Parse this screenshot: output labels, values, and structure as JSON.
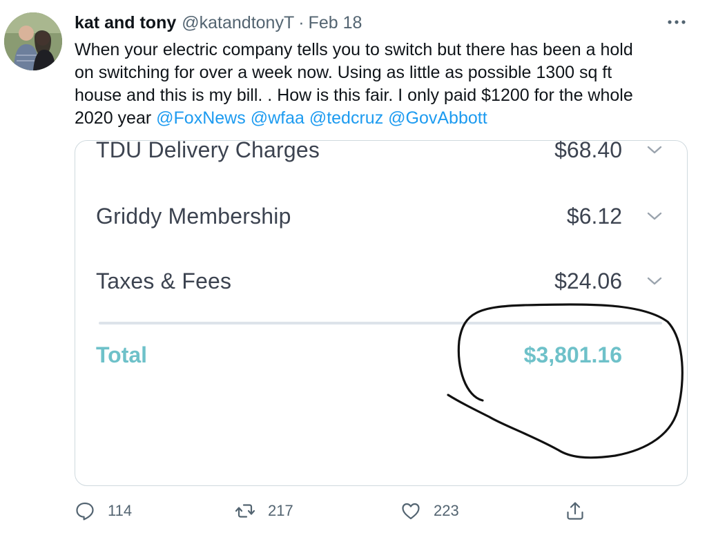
{
  "author": {
    "name": "kat and tony",
    "handle": "@katandtonyT",
    "separator": "·",
    "date": "Feb 18"
  },
  "tweet": {
    "text_lines": [
      "When your electric company tells you to switch but there has been a hold",
      "on switching for over  a week now. Using as little as possible 1300 sq ft",
      "house and this is my bill. . How is this fair. I only paid $1200 for the whole"
    ],
    "last_line_text": "2020 year",
    "mentions": [
      "@FoxNews",
      "@wfaa",
      "@tedcruz",
      "@GovAbbott"
    ]
  },
  "bill": {
    "rows": [
      {
        "label": "TDU Delivery Charges",
        "amount": "$68.40"
      },
      {
        "label": "Griddy Membership",
        "amount": "$6.12"
      },
      {
        "label": "Taxes & Fees",
        "amount": "$24.06"
      }
    ],
    "total_label": "Total",
    "total_amount": "$3,801.16"
  },
  "actions": {
    "reply_count": "114",
    "retweet_count": "217",
    "like_count": "223"
  },
  "icons": {
    "more": "more-icon",
    "reply": "reply-icon",
    "retweet": "retweet-icon",
    "like": "heart-icon",
    "share": "share-icon",
    "chevron": "chevron-down-icon"
  },
  "colors": {
    "link": "#1d9bf0",
    "total": "#6ec1c9",
    "muted": "#536471"
  }
}
